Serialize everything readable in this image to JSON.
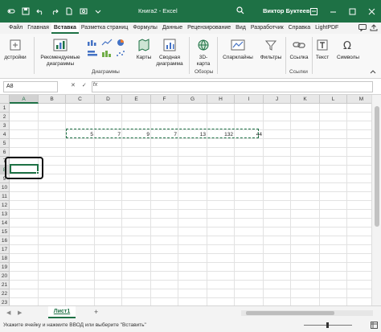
{
  "window": {
    "title": "Книга2 - Excel",
    "user": "Виктор Буктеев"
  },
  "tabs": [
    {
      "label": "Файл"
    },
    {
      "label": "Главная"
    },
    {
      "label": "Вставка"
    },
    {
      "label": "Разметка страниц"
    },
    {
      "label": "Формулы"
    },
    {
      "label": "Данные"
    },
    {
      "label": "Рецензирование"
    },
    {
      "label": "Вид"
    },
    {
      "label": "Разработчик"
    },
    {
      "label": "Справка"
    },
    {
      "label": "LightPDF"
    }
  ],
  "active_tab": "Вставка",
  "ribbon": {
    "buttons": [
      {
        "label": "дстройки",
        "icon": "addins-icon"
      },
      {
        "label": "Рекомендуемые диаграммы",
        "icon": "recommended-charts-icon"
      },
      {
        "label": "Карты",
        "icon": "maps-icon"
      },
      {
        "label": "Сводная диаграмма",
        "icon": "pivot-chart-icon"
      },
      {
        "label": "3D-карта",
        "icon": "3d-map-icon"
      },
      {
        "label": "Спарклайны",
        "icon": "sparklines-icon"
      },
      {
        "label": "Фильтры",
        "icon": "filters-icon"
      },
      {
        "label": "Ссылка",
        "icon": "link-icon"
      },
      {
        "label": "Текст",
        "icon": "text-icon"
      },
      {
        "label": "Символы",
        "icon": "symbols-icon"
      }
    ],
    "groups": [
      "Диаграммы",
      "Обзоры",
      "Ссылки"
    ]
  },
  "formula_bar": {
    "name_box": "A8",
    "fx": "fx",
    "value": ""
  },
  "columns": [
    "A",
    "B",
    "C",
    "D",
    "E",
    "F",
    "G",
    "H",
    "I",
    "J",
    "K",
    "L",
    "M"
  ],
  "rows": [
    "1",
    "2",
    "3",
    "4",
    "5",
    "6",
    "7",
    "8",
    "9",
    "10",
    "11",
    "12",
    "13",
    "14",
    "15",
    "16",
    "17",
    "18",
    "19",
    "20",
    "21",
    "22",
    "23"
  ],
  "cells": {
    "row4": [
      "5",
      "7",
      "9",
      "7",
      "13",
      "132",
      "44"
    ]
  },
  "sheets": [
    {
      "name": "Лист1"
    }
  ],
  "status": {
    "message": "Укажите ячейку и нажмите ВВОД или выберите \"Вставить\""
  },
  "colors": {
    "accent": "#1e7145"
  }
}
